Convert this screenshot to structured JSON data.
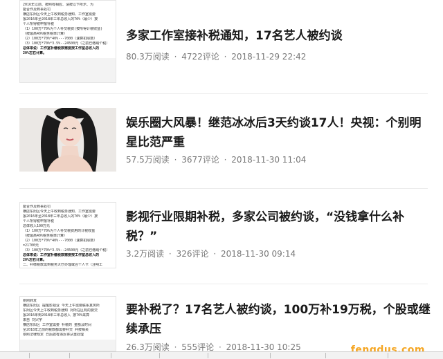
{
  "articles": [
    {
      "title": "多家工作室接补税通知，17名艺人被约谈",
      "views": "80.3万阅读",
      "comments": "4722评论",
      "time": "2018-11-29 22:42",
      "thumb_lines": [
        "2016年以前、按照有相应、请按以下所示、为",
        "能合作及到事处罚",
        "横店东阳区今天上午收到税务通知、工作室需要",
        "报2016年至2018年三年总收入的70%（最少）按",
        "个人所得税申报补税",
        "（1）100万*70%为个人补交税费(按所得计税收益)",
        "（按最高40%税务税率计算）",
        "（2）100万*70%*40%---7000（速算扣除数）",
        "（3）100万*70%*3.5%--24500元（之前已缴纳个税）",
        "总体来说：工作室补缴税款需要按工作室总收入的",
        "20%左右计算。"
      ]
    },
    {
      "title": "娱乐圈大风暴！继范冰冰后3天约谈17人！央视：个别明星比范严重",
      "views": "57.5万阅读",
      "comments": "3677评论",
      "time": "2018-11-30 11:04"
    },
    {
      "title": "影视行业限期补税，多家公司被约谈，“没钱拿什么补税？”",
      "views": "3.2万阅读",
      "comments": "326评论",
      "time": "2018-11-30 09:14",
      "thumb_lines": [
        "能合作及到事处罚",
        "横店东阳区今天上午收到税务通知、工作室需要",
        "报2016年至2018年三年总收入的70%（最少）按",
        "个人所得税申报补税",
        "总体收入100万元",
        "（1）100万*70%为个人补交税费用的计税收益",
        "（按最高40%税务税率计算）",
        "（2）100万*70%*40%---7000（速算扣除数）",
        "=21700元",
        "（3）100万*70%*3.5%--24500元（之前已缴纳个税）",
        "总体来说：工作室补缴税款需要按工作室总收入的",
        "20%左右计算。",
        "二、补缴税款需到税务大厅办理或合个人卡（注明工"
      ]
    },
    {
      "title": "要补税了？17名艺人被约谈，100万补19万税，个股或继续承压",
      "views": "26.3万阅读",
      "comments": "555评论",
      "time": "2018-11-30 10:25",
      "thumb_lines": [
        "刚刚转发",
        "横店东阳区 提醒影视业 今天上午需要联系其务所",
        "东阳区今天上午收到税务通知 对所在区有的要交",
        "报2016年到2018年三年总收入 按70%来算",
        "来自 刘兴宇",
        "横店东阳区 工作室需要 补税的 金额及时间",
        "至2018年之前的税款都需要补交 并按相关",
        "依照法律规定 日后如有违反将从重处理"
      ]
    }
  ],
  "meta_separator": "·",
  "watermark": "fengdus.com"
}
